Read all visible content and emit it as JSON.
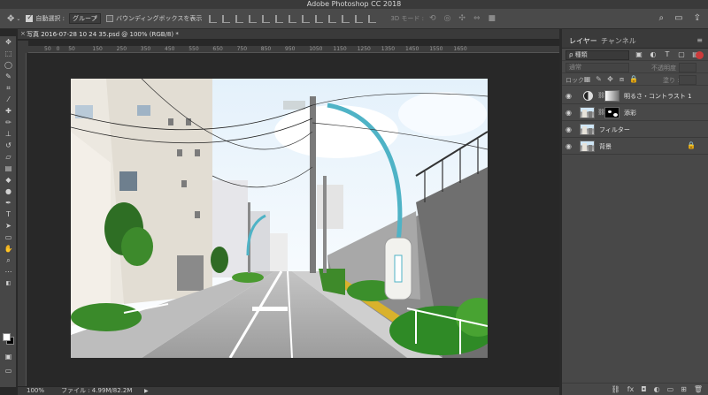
{
  "window": {
    "title": "Adobe Photoshop CC 2018"
  },
  "options": {
    "move_tool_icon": "move-arrows-icon",
    "auto_select_label": "自動選択 :",
    "auto_select_checked": true,
    "auto_select_value": "グループ",
    "bounding_box_label": "バウンディングボックスを表示",
    "bounding_box_checked": false,
    "mode_3d_label": "3D モード :"
  },
  "document": {
    "tab_title": "写真 2016-07-28 10 24 35.psd @ 100% (RGB/8) *",
    "ruler_ticks": [
      "50",
      "0",
      "50",
      "100",
      "150",
      "200",
      "250",
      "300",
      "350",
      "400",
      "450",
      "500",
      "550",
      "600",
      "650",
      "700",
      "750",
      "800",
      "850",
      "900",
      "950",
      "1000",
      "1050",
      "1100",
      "1150",
      "1200",
      "1250",
      "1300",
      "1350",
      "1400",
      "1450",
      "1500",
      "1550",
      "1600",
      "1650",
      "1700"
    ]
  },
  "status": {
    "zoom": "100%",
    "file_info": "ファイル : 4.99M/82.2M",
    "arrow": "▶"
  },
  "panel": {
    "tabs": [
      {
        "label": "レイヤー",
        "active": true
      },
      {
        "label": "チャンネル",
        "active": false
      }
    ],
    "menu_icon": "≡",
    "kind_filter": "ρ 種類",
    "blend_mode": "通常",
    "opacity_label": "不透明度 :",
    "lock_label": "ロック :",
    "fill_label": "塗り :",
    "layers": [
      {
        "name": "明るさ・コントラスト 1",
        "type": "adjustment",
        "visible": true,
        "locked": false
      },
      {
        "name": "添彩",
        "type": "masked",
        "visible": true,
        "locked": false
      },
      {
        "name": "フィルター",
        "type": "normal",
        "visible": true,
        "locked": false
      },
      {
        "name": "背景",
        "type": "normal",
        "visible": true,
        "locked": true
      }
    ],
    "bottom_icons": [
      "link-icon",
      "fx-icon",
      "mask-icon",
      "adjustment-icon",
      "folder-icon",
      "new-layer-icon",
      "trash-icon"
    ]
  },
  "colors": {
    "foreground": "#ffffff",
    "background": "#000000",
    "accent_filter_toggle": "#cc3b3b"
  }
}
